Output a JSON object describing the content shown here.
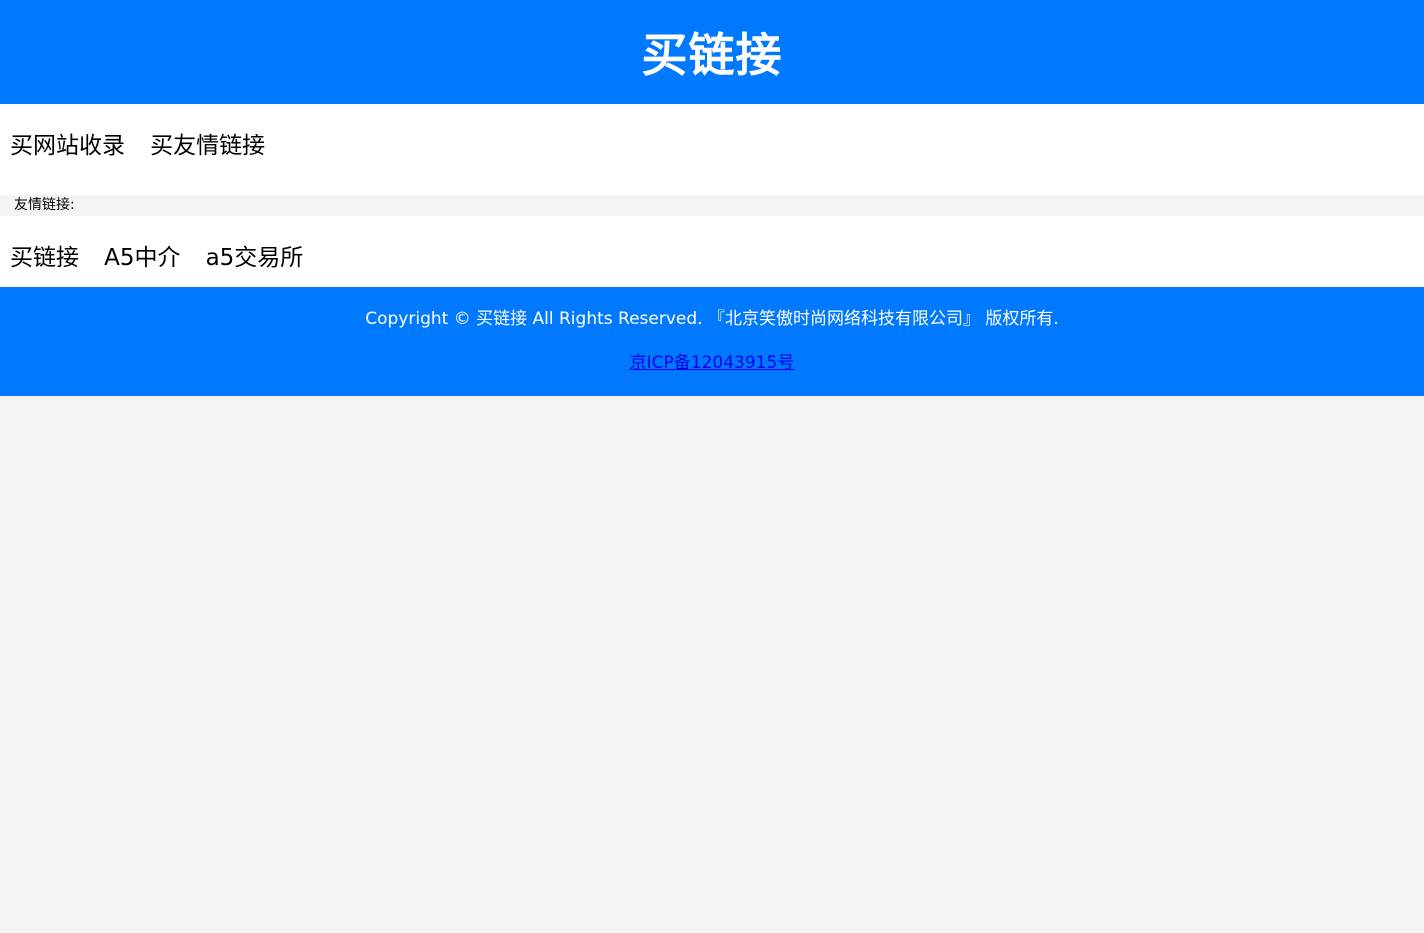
{
  "header": {
    "title": "买链接"
  },
  "nav": {
    "items": [
      {
        "label": "买网站收录"
      },
      {
        "label": "买友情链接"
      }
    ]
  },
  "friend_links": {
    "label": "友情链接:",
    "items": [
      {
        "label": "买链接"
      },
      {
        "label": "A5中介"
      },
      {
        "label": "a5交易所"
      }
    ]
  },
  "footer": {
    "copyright": "Copyright © 买链接 All Rights Reserved. 『北京笑傲时尚网络科技有限公司』 版权所有.",
    "icp": "京ICP备12043915号"
  },
  "colors": {
    "brand_blue": "#0079fe",
    "page_bg": "#f4f4f4",
    "link_blue": "#0000ee"
  }
}
